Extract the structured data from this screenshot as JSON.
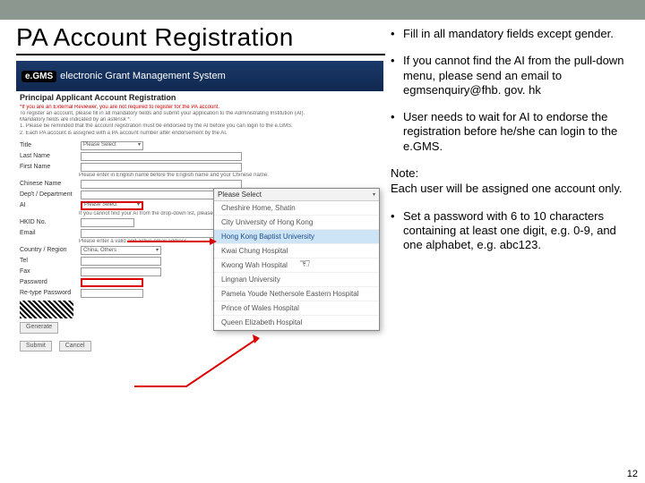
{
  "title": "PA Account Registration",
  "banner": {
    "logo": "e.GMS",
    "text": "electronic Grant Management System"
  },
  "form": {
    "heading": "Principal Applicant Account Registration",
    "intro_red": "*If you are an External Reviewer, you are not required to register for the PA account.",
    "intro1": "To register an account, please fill in all mandatory fields and submit your application to the Administrating Institution (AI).",
    "intro2": "Mandatory fields are indicated by an asterisk *.",
    "intro3": "1. Please be reminded that the account registration must be endorsed by the AI before you can login to the e.GMS.",
    "intro4": "2. Each PA account is assigned with a PA account number after endorsement by the AI.",
    "label_title": "Title",
    "label_lastname": "Last Name",
    "label_firstname": "First Name",
    "label_cname_hint": "Please enter in English name before the English name and your Chinese name.",
    "label_cname": "Chinese Name",
    "label_dept": "Dep't / Department",
    "label_ai": "AI",
    "label_ai_hint": "If you cannot find your AI from the drop-down list, please send an email to egmsenquiry@fhb.gov.hk.",
    "label_hkid": "HKID No.",
    "label_email": "Email",
    "label_email_hint": "Please enter a valid and active email address.",
    "label_country": "Country / Region",
    "label_tel": "Tel",
    "label_fax": "Fax",
    "label_password": "Password",
    "label_pwconfirm": "Re-type Password",
    "select_placeholder": "Please Select",
    "country_placeholder": "China, Others",
    "captcha_btn": "Generate",
    "btn_submit": "Submit",
    "btn_cancel": "Cancel"
  },
  "popup": {
    "header": "Please Select",
    "items": [
      "Cheshire Home, Shatin",
      "City University of Hong Kong",
      "Hong Kong Baptist University",
      "Kwai Chung Hospital",
      "Kwong Wah Hospital",
      "Lingnan University",
      "Pamela Youde Nethersole Eastern Hospital",
      "Prince of Wales Hospital",
      "Queen Elizabeth Hospital"
    ],
    "highlight_index": 2
  },
  "bullets": [
    "Fill in all mandatory fields except gender.",
    "If you cannot find the AI from the pull-down menu, please send an email to egmsenquiry@fhb. gov. hk",
    "User needs to wait for AI to endorse the registration before he/she can login to the e.GMS."
  ],
  "note": "Note:\nEach user will be assigned one account only.",
  "bullet4": "Set a password with 6 to 10 characters containing at least one digit, e.g. 0-9, and one alphabet, e.g. abc123.",
  "pagenum": "12"
}
